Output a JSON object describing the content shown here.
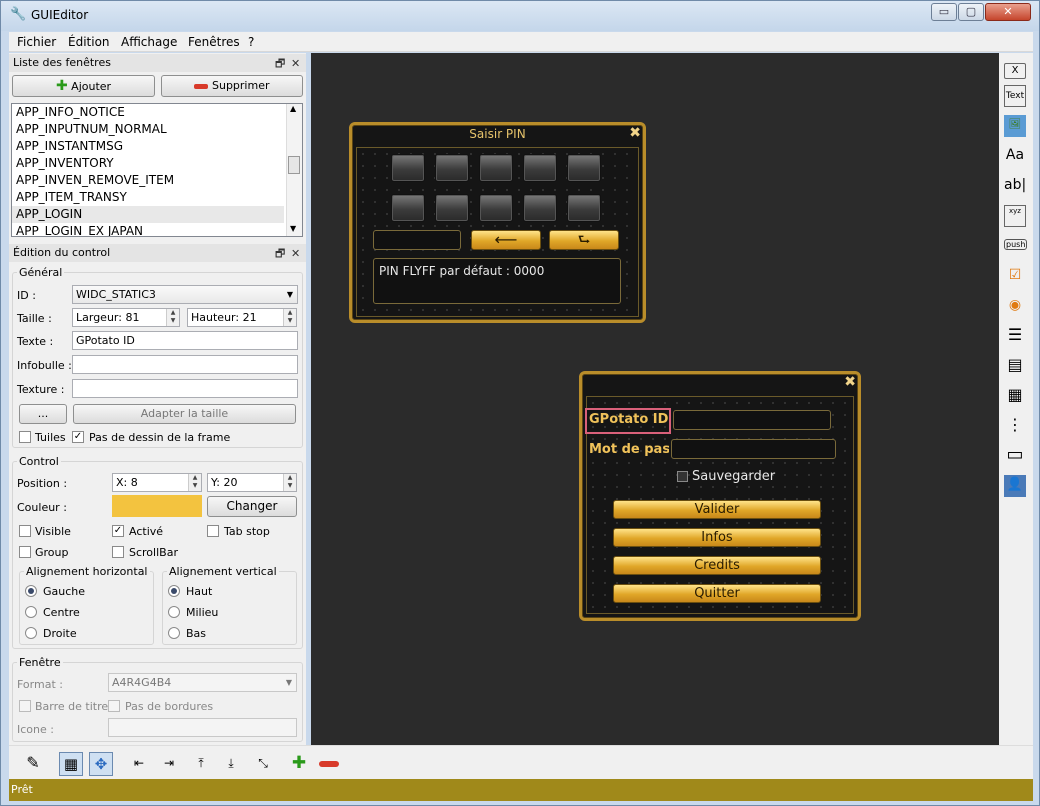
{
  "window": {
    "title": "GUIEditor",
    "min_label": "▭",
    "max_label": "▢",
    "close_label": "✕"
  },
  "menu": [
    "Fichier",
    "Édition",
    "Affichage",
    "Fenêtres",
    "?"
  ],
  "window_list": {
    "title": "Liste des fenêtres",
    "add_label": "Ajouter",
    "remove_label": "Supprimer",
    "items": [
      "APP_INFO_NOTICE",
      "APP_INPUTNUM_NORMAL",
      "APP_INSTANTMSG",
      "APP_INVENTORY",
      "APP_INVEN_REMOVE_ITEM",
      "APP_ITEM_TRANSY",
      "APP_LOGIN",
      "APP_LOGIN_EX JAPAN"
    ],
    "selected": "APP_LOGIN"
  },
  "control_edit": {
    "title": "Édition du control",
    "general_label": "Général",
    "id_label": "ID :",
    "id_value": "WIDC_STATIC3",
    "size_label": "Taille :",
    "width_value": "Largeur: 81",
    "height_value": "Hauteur: 21",
    "text_label": "Texte :",
    "text_value": "GPotato ID",
    "tooltip_label": "Infobulle :",
    "texture_label": "Texture :",
    "browse_label": "...",
    "fit_label": "Adapter la taille",
    "tiles_label": "Tuiles",
    "noframe_label": "Pas de dessin de la frame",
    "control_label": "Control",
    "position_label": "Position :",
    "x_value": "X: 8",
    "y_value": "Y: 20",
    "color_label": "Couleur :",
    "color_value": "#f3c33f",
    "change_label": "Changer",
    "visible_label": "Visible",
    "active_label": "Activé",
    "tabstop_label": "Tab stop",
    "group_label": "Group",
    "scrollbar_label": "ScrollBar",
    "halign_label": "Alignement horizontal",
    "halign_options": [
      "Gauche",
      "Centre",
      "Droite"
    ],
    "valign_label": "Alignement vertical",
    "valign_options": [
      "Haut",
      "Milieu",
      "Bas"
    ],
    "window_label": "Fenêtre",
    "format_label": "Format :",
    "format_value": "A4R4G4B4",
    "titlebar_label": "Barre de titre",
    "noborder_label": "Pas de bordures",
    "icon_label": "Icone :"
  },
  "pin_window": {
    "title": "Saisir PIN",
    "close": "✖",
    "back_arrow": "⟵",
    "enter_arrow": "⮑",
    "info": "PIN FLYFF par défaut : 0000"
  },
  "login_window": {
    "close": "✖",
    "id_label": "GPotato ID",
    "password_label": "Mot de passe",
    "save_label": "Sauvegarder",
    "buttons": [
      "Valider",
      "Infos",
      "Credits",
      "Quitter"
    ]
  },
  "toolbox": [
    "X",
    "Text",
    "🖼",
    "Aa",
    "ab|",
    "xyz",
    "push",
    "☑",
    "◉",
    "☰",
    "▤",
    "▦",
    "⋮",
    "▭",
    "👤"
  ],
  "status": "Prêt",
  "accent_color": "#a0891a"
}
